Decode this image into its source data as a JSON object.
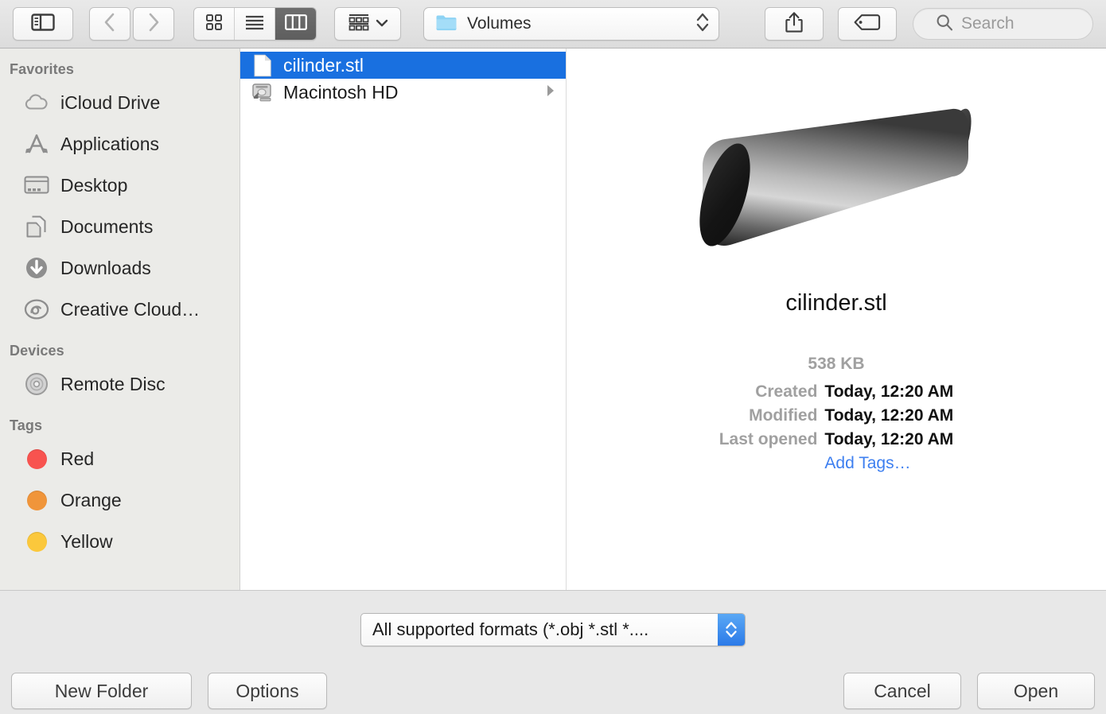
{
  "toolbar": {
    "sidebar_toggle_icon": "sidebar-toggle-icon",
    "back_icon": "chevron-left-icon",
    "forward_icon": "chevron-right-icon",
    "view_modes": [
      {
        "name": "icon-view",
        "icon": "grid-icon",
        "active": false
      },
      {
        "name": "list-view",
        "icon": "list-icon",
        "active": false
      },
      {
        "name": "column-view",
        "icon": "columns-icon",
        "active": true
      }
    ],
    "arrange_icon": "arrange-icon",
    "arrange_chevron_icon": "chevron-down-icon",
    "path_label": "Volumes",
    "path_folder_icon": "folder-icon",
    "path_stepper_icon": "up-down-arrows-icon",
    "share_icon": "share-icon",
    "tag_icon": "tag-icon",
    "search_icon": "search-icon",
    "search_placeholder": "Search",
    "search_value": ""
  },
  "sidebar": {
    "sections": [
      {
        "header": "Favorites",
        "items": [
          {
            "label": "iCloud Drive",
            "icon": "cloud-icon"
          },
          {
            "label": "Applications",
            "icon": "applications-icon"
          },
          {
            "label": "Desktop",
            "icon": "desktop-icon"
          },
          {
            "label": "Documents",
            "icon": "documents-icon"
          },
          {
            "label": "Downloads",
            "icon": "downloads-icon"
          },
          {
            "label": "Creative Cloud…",
            "icon": "creative-cloud-icon"
          }
        ]
      },
      {
        "header": "Devices",
        "items": [
          {
            "label": "Remote Disc",
            "icon": "optical-disc-icon"
          }
        ]
      },
      {
        "header": "Tags",
        "items": [
          {
            "label": "Red",
            "icon": "tag-dot-icon",
            "color": "#f8534f"
          },
          {
            "label": "Orange",
            "icon": "tag-dot-icon",
            "color": "#f0953a"
          },
          {
            "label": "Yellow",
            "icon": "tag-dot-icon",
            "color": "#fbc83c"
          }
        ]
      }
    ]
  },
  "file_list": {
    "rows": [
      {
        "name": "cilinder.stl",
        "icon": "document-file-icon",
        "selected": true,
        "has_disclosure": false
      },
      {
        "name": "Macintosh HD",
        "icon": "hard-drive-icon",
        "selected": false,
        "has_disclosure": true
      }
    ]
  },
  "preview": {
    "image_alt": "3d-cone-model-preview",
    "filename": "cilinder.stl",
    "size": "538 KB",
    "metadata": [
      {
        "key": "Created",
        "value": "Today, 12:20 AM"
      },
      {
        "key": "Modified",
        "value": "Today, 12:20 AM"
      },
      {
        "key": "Last opened",
        "value": "Today, 12:20 AM"
      }
    ],
    "add_tags_label": "Add Tags…"
  },
  "bottom": {
    "format_label": "All supported formats (*.obj *.stl *....",
    "format_stepper_icon": "up-down-arrows-icon",
    "new_folder_label": "New Folder",
    "options_label": "Options",
    "cancel_label": "Cancel",
    "open_label": "Open"
  },
  "colors": {
    "selection_blue": "#1970e0",
    "link_blue": "#3d7ff0",
    "stepper_blue": "#2b7ae8",
    "sidebar_bg": "#ebebe8",
    "bottom_bg": "#e8e8e8"
  }
}
